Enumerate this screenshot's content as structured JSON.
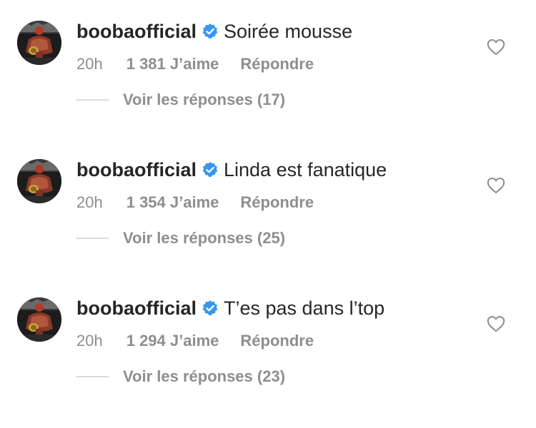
{
  "comments": [
    {
      "username": "boobaofficial",
      "text": "Soirée mousse",
      "time": "20h",
      "likes": "1 381 J’aime",
      "reply": "Répondre",
      "view_replies": "Voir les réponses (17)"
    },
    {
      "username": "boobaofficial",
      "text": "Linda est fanatique",
      "time": "20h",
      "likes": "1 354 J’aime",
      "reply": "Répondre",
      "view_replies": "Voir les réponses (25)"
    },
    {
      "username": "boobaofficial",
      "text": "T’es pas dans l’top",
      "time": "20h",
      "likes": "1 294 J’aime",
      "reply": "Répondre",
      "view_replies": "Voir les réponses (23)"
    }
  ],
  "icons": {
    "verified": "verified-badge-icon",
    "like": "heart-icon"
  },
  "colors": {
    "primary_text": "#262626",
    "secondary_text": "#8e8e8e",
    "verified_blue": "#3897f0",
    "divider": "#dbdbdb"
  }
}
